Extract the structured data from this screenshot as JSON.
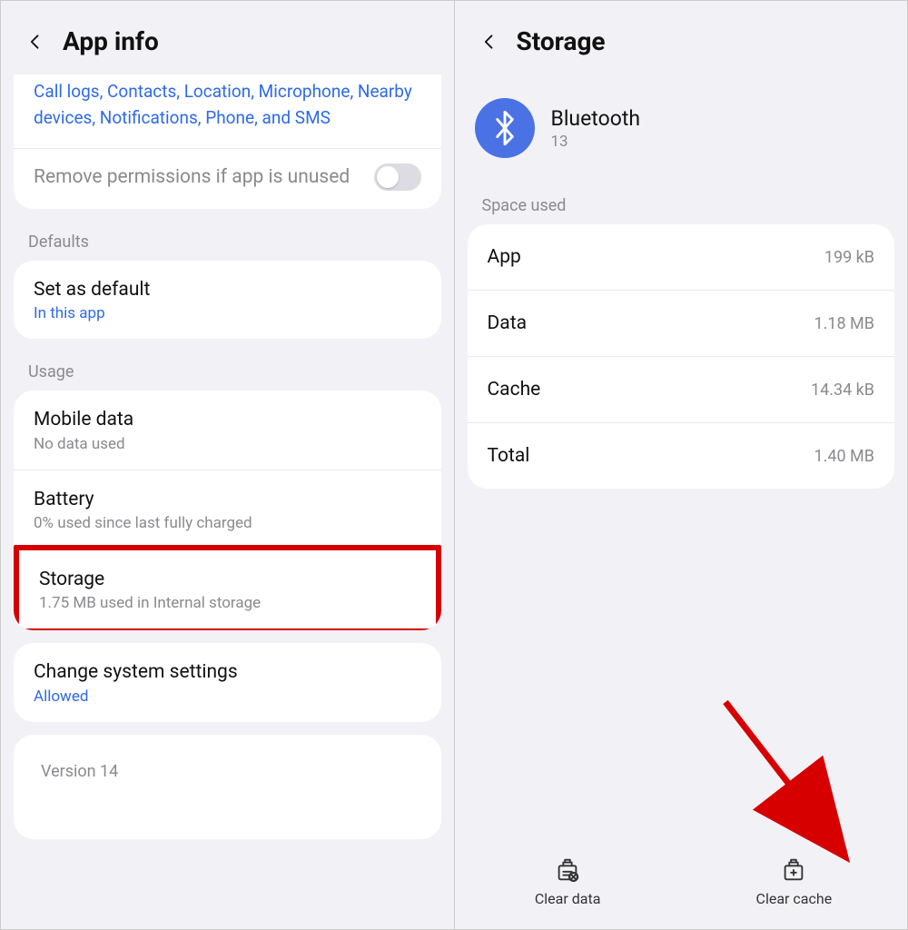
{
  "left": {
    "title": "App info",
    "permissions_text": "Call logs, Contacts, Location, Microphone, Nearby devices, Notifications, Phone, and SMS",
    "remove_permissions": "Remove permissions if app is unused",
    "defaults_label": "Defaults",
    "set_default_title": "Set as default",
    "set_default_sub": "In this app",
    "usage_label": "Usage",
    "mobile_data_title": "Mobile data",
    "mobile_data_sub": "No data used",
    "battery_title": "Battery",
    "battery_sub": "0% used since last fully charged",
    "storage_title": "Storage",
    "storage_sub": "1.75 MB used in Internal storage",
    "change_sys_title": "Change system settings",
    "change_sys_sub": "Allowed",
    "version": "Version 14"
  },
  "right": {
    "title": "Storage",
    "app_name": "Bluetooth",
    "app_version": "13",
    "space_used_label": "Space used",
    "rows": {
      "app_k": "App",
      "app_v": "199 kB",
      "data_k": "Data",
      "data_v": "1.18 MB",
      "cache_k": "Cache",
      "cache_v": "14.34 kB",
      "total_k": "Total",
      "total_v": "1.40 MB"
    },
    "clear_data": "Clear data",
    "clear_cache": "Clear cache"
  }
}
